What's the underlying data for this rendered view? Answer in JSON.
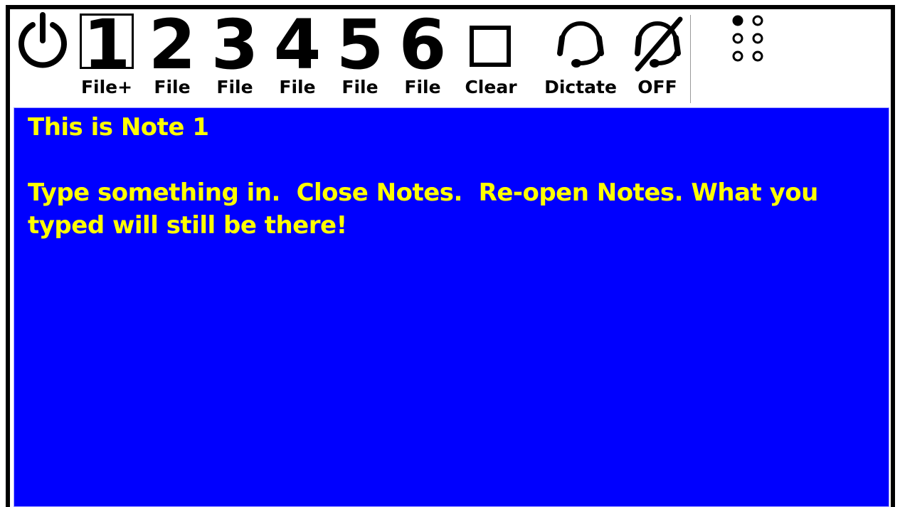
{
  "toolbar": {
    "power": {
      "icon": "power-icon"
    },
    "files": [
      {
        "number": "1",
        "label": "File+",
        "selected": true
      },
      {
        "number": "2",
        "label": "File"
      },
      {
        "number": "3",
        "label": "File"
      },
      {
        "number": "4",
        "label": "File"
      },
      {
        "number": "5",
        "label": "File"
      },
      {
        "number": "6",
        "label": "File"
      }
    ],
    "clear": {
      "label": "Clear",
      "icon": "square-outline-icon"
    },
    "dictate": {
      "label": "Dictate",
      "icon": "headset-icon"
    },
    "dictate_off": {
      "label": "OFF",
      "icon": "headset-off-icon"
    },
    "menu": {
      "icon": "dots-grid-icon"
    }
  },
  "note": {
    "text": "This is Note 1\n\nType something in.  Close Notes.  Re-open Notes. What you typed will still be there!"
  },
  "colors": {
    "note_background": "#0000ff",
    "note_text": "#ffff00",
    "frame": "#000000"
  }
}
